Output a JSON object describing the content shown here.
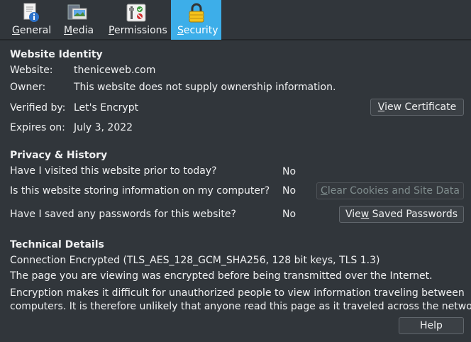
{
  "tabs": [
    {
      "label": "General",
      "mnemonic_index": 0,
      "icon": "document-info-icon",
      "active": false
    },
    {
      "label": "Media",
      "mnemonic_index": 0,
      "icon": "media-images-icon",
      "active": false
    },
    {
      "label": "Permissions",
      "mnemonic_index": 0,
      "icon": "permissions-icon",
      "active": false
    },
    {
      "label": "Security",
      "mnemonic_index": 0,
      "icon": "padlock-icon",
      "active": true
    }
  ],
  "identity": {
    "heading": "Website Identity",
    "website_label": "Website:",
    "website_value": "theniceweb.com",
    "owner_label": "Owner:",
    "owner_value": "This website does not supply ownership information.",
    "verified_label": "Verified by:",
    "verified_value": "Let's Encrypt",
    "expires_label": "Expires on:",
    "expires_value": "July 3, 2022",
    "view_cert_button": "View Certificate"
  },
  "privacy": {
    "heading": "Privacy & History",
    "q1": "Have I visited this website prior to today?",
    "a1": "No",
    "q2": "Is this website storing information on my computer?",
    "a2": "No",
    "clear_button": "Clear Cookies and Site Data",
    "q3": "Have I saved any passwords for this website?",
    "a3": "No",
    "passwords_button": "View Saved Passwords"
  },
  "technical": {
    "heading": "Technical Details",
    "line1": "Connection Encrypted (TLS_AES_128_GCM_SHA256, 128 bit keys, TLS 1.3)",
    "line2": "The page you are viewing was encrypted before being transmitted over the Internet.",
    "line3": "Encryption makes it difficult for unauthorized people to view information traveling between",
    "line4": "computers. It is therefore unlikely that anyone read this page as it traveled across the network."
  },
  "help_button": "Help",
  "colors": {
    "background": "#31363b",
    "accent": "#3daee9",
    "text": "#eff0f1",
    "disabled_text": "#7f8c8d"
  }
}
